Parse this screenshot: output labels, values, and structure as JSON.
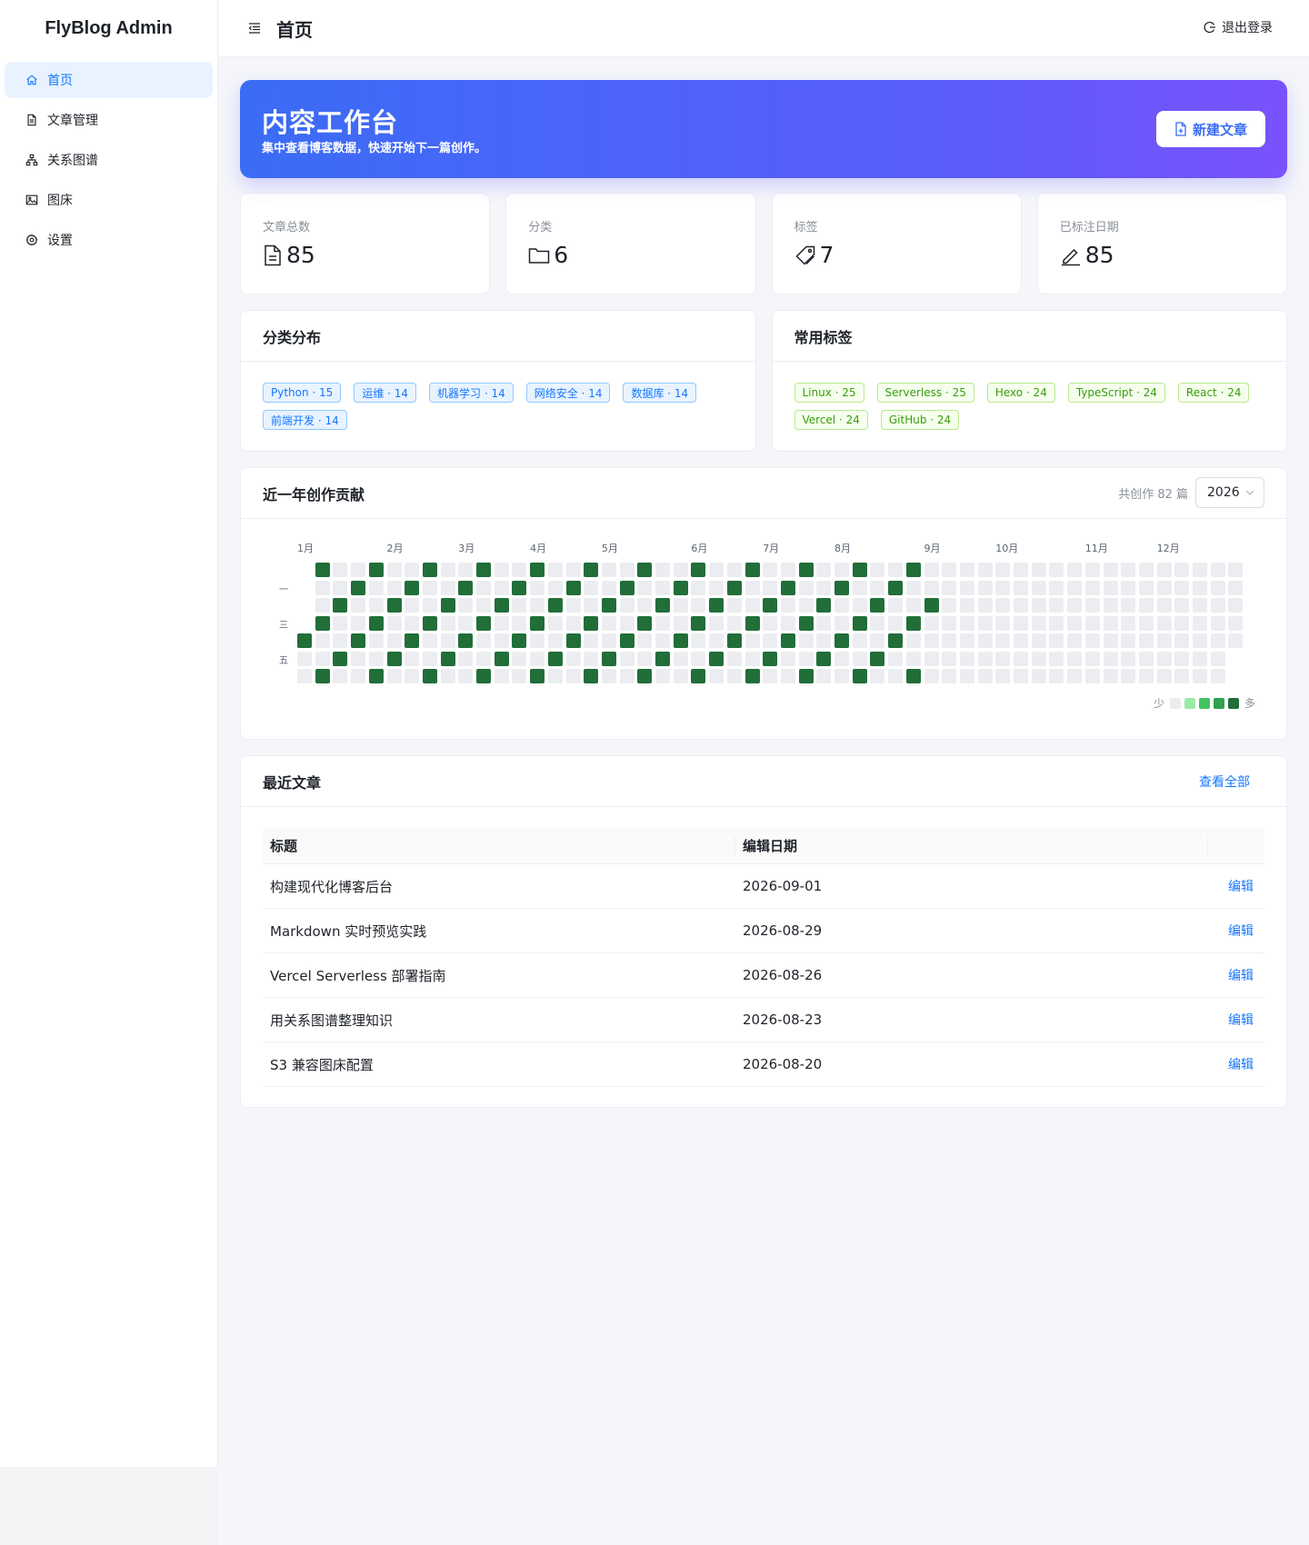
{
  "app": {
    "brand": "FlyBlog Admin"
  },
  "sidebar": {
    "items": [
      {
        "label": "首页",
        "icon": "home-icon",
        "active": true
      },
      {
        "label": "文章管理",
        "icon": "document-icon",
        "active": false
      },
      {
        "label": "关系图谱",
        "icon": "sitemap-icon",
        "active": false
      },
      {
        "label": "图床",
        "icon": "image-icon",
        "active": false
      },
      {
        "label": "设置",
        "icon": "gear-icon",
        "active": false
      }
    ]
  },
  "header": {
    "title": "首页",
    "logout_label": "退出登录"
  },
  "hero": {
    "title": "内容工作台",
    "subtitle": "集中查看博客数据，快速开始下一篇创作。",
    "new_button_label": "新建文章"
  },
  "stats": [
    {
      "label": "文章总数",
      "value": "85",
      "icon": "file-text-icon"
    },
    {
      "label": "分类",
      "value": "6",
      "icon": "folder-icon"
    },
    {
      "label": "标签",
      "value": "7",
      "icon": "tags-icon"
    },
    {
      "label": "已标注日期",
      "value": "85",
      "icon": "edit-icon"
    }
  ],
  "categories": {
    "title": "分类分布",
    "tags": [
      "Python · 15",
      "运维 · 14",
      "机器学习 · 14",
      "网络安全 · 14",
      "数据库 · 14",
      "前端开发 · 14"
    ]
  },
  "common_tags": {
    "title": "常用标签",
    "tags": [
      "Linux · 25",
      "Serverless · 25",
      "Hexo · 24",
      "TypeScript · 24",
      "React · 24",
      "Vercel · 24",
      "GitHub · 24"
    ]
  },
  "contributions": {
    "title": "近一年创作贡献",
    "total_label": "共创作 82 篇",
    "year": "2026",
    "months": [
      "1月",
      "2月",
      "3月",
      "4月",
      "5月",
      "6月",
      "7月",
      "8月",
      "9月",
      "10月",
      "11月",
      "12月"
    ],
    "weekday_labels": [
      "一",
      "三",
      "五"
    ],
    "legend_less": "少",
    "legend_more": "多",
    "colors": [
      "#ebedf0",
      "#9be9a8",
      "#40c463",
      "#30a14e",
      "#216e39"
    ]
  },
  "recent": {
    "title": "最近文章",
    "view_all_label": "查看全部",
    "columns": [
      "标题",
      "编辑日期"
    ],
    "rows": [
      {
        "title": "构建现代化博客后台",
        "date": "2026-09-01",
        "action": "编辑"
      },
      {
        "title": "Markdown 实时预览实践",
        "date": "2026-08-29",
        "action": "编辑"
      },
      {
        "title": "Vercel Serverless 部署指南",
        "date": "2026-08-26",
        "action": "编辑"
      },
      {
        "title": "用关系图谱整理知识",
        "date": "2026-08-23",
        "action": "编辑"
      },
      {
        "title": "S3 兼容图床配置",
        "date": "2026-08-20",
        "action": "编辑"
      }
    ]
  }
}
